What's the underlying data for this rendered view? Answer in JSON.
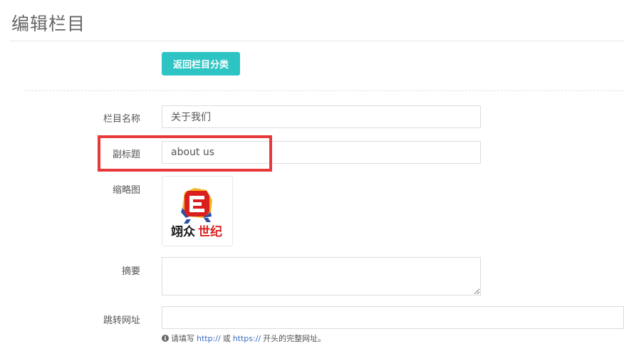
{
  "page": {
    "title": "编辑栏目"
  },
  "toolbar": {
    "back_label": "返回栏目分类"
  },
  "form": {
    "name": {
      "label": "栏目名称",
      "value": "关于我们"
    },
    "subtitle": {
      "label": "副标题",
      "value": "about us"
    },
    "thumbnail": {
      "label": "缩略图",
      "logo_text_black": "翊众",
      "logo_text_red": "世纪"
    },
    "summary": {
      "label": "摘要",
      "value": ""
    },
    "redirect": {
      "label": "跳转网址",
      "value": "",
      "help": {
        "prefix": "请填写",
        "http": "http://",
        "or": "或",
        "https": "https://",
        "suffix": "开头的完整网址。"
      }
    }
  },
  "colors": {
    "accent": "#2ec4c4",
    "highlight": "#e8393a",
    "logo_red": "#d9201f",
    "logo_blue": "#2a4fa3",
    "logo_yellow": "#f4b51f",
    "link": "#3a6ec4"
  },
  "icons": {
    "info": "info-circle-icon"
  }
}
